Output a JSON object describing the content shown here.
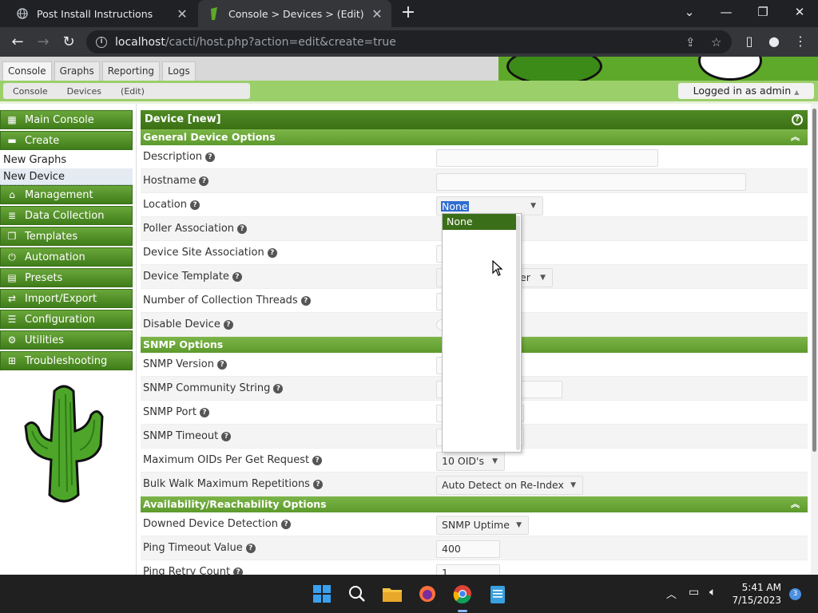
{
  "browser": {
    "tabs": [
      {
        "title": "Post Install Instructions",
        "active": false
      },
      {
        "title": "Console > Devices > (Edit)",
        "active": true
      }
    ],
    "url_host": "localhost",
    "url_path": "/cacti/host.php?action=edit&create=true"
  },
  "cacti": {
    "main_tabs": [
      "Console",
      "Graphs",
      "Reporting",
      "Logs"
    ],
    "breadcrumbs": [
      "Console",
      "Devices",
      "(Edit)"
    ],
    "login_text": "Logged in as admin"
  },
  "sidebar": {
    "items": [
      {
        "label": "Main Console",
        "icon": "map-icon"
      },
      {
        "label": "Create",
        "icon": "plus-icon"
      },
      {
        "label": "Management",
        "icon": "home-icon"
      },
      {
        "label": "Data Collection",
        "icon": "database-icon"
      },
      {
        "label": "Templates",
        "icon": "copy-icon"
      },
      {
        "label": "Automation",
        "icon": "power-icon"
      },
      {
        "label": "Presets",
        "icon": "archive-icon"
      },
      {
        "label": "Import/Export",
        "icon": "exchange-icon"
      },
      {
        "label": "Configuration",
        "icon": "sliders-icon"
      },
      {
        "label": "Utilities",
        "icon": "cogs-icon"
      },
      {
        "label": "Troubleshooting",
        "icon": "sitemap-icon"
      }
    ],
    "sub_items": [
      "New Graphs",
      "New Device"
    ]
  },
  "form": {
    "title": "Device [new]",
    "sections": {
      "general": "General Device Options",
      "snmp": "SNMP Options",
      "availability": "Availability/Reachability Options"
    },
    "rows": {
      "description": "Description",
      "hostname": "Hostname",
      "location": "Location",
      "poller": "Poller Association",
      "site": "Device Site Association",
      "template": "Device Template",
      "threads": "Number of Collection Threads",
      "disable": "Disable Device",
      "snmp_version": "SNMP Version",
      "snmp_community": "SNMP Community String",
      "snmp_port": "SNMP Port",
      "snmp_timeout": "SNMP Timeout",
      "max_oids": "Maximum OIDs Per Get Request",
      "bulk_walk": "Bulk Walk Maximum Repetitions",
      "downed": "Downed Device Detection",
      "ping_timeout": "Ping Timeout Value",
      "ping_retry": "Ping Retry Count"
    },
    "values": {
      "location": "None",
      "template_partial": "er",
      "max_oids": "10 OID's",
      "bulk_walk": "Auto Detect on Re-Index",
      "downed": "SNMP Uptime",
      "ping_timeout": "400",
      "ping_retry": "1"
    },
    "location_options": [
      "None"
    ]
  },
  "taskbar": {
    "time": "5:41 AM",
    "date": "7/15/2023",
    "notifications": "3"
  },
  "colors": {
    "cacti_green_dark": "#3b7014",
    "cacti_green_light": "#7cb548",
    "selection_blue": "#2f6cd1"
  }
}
